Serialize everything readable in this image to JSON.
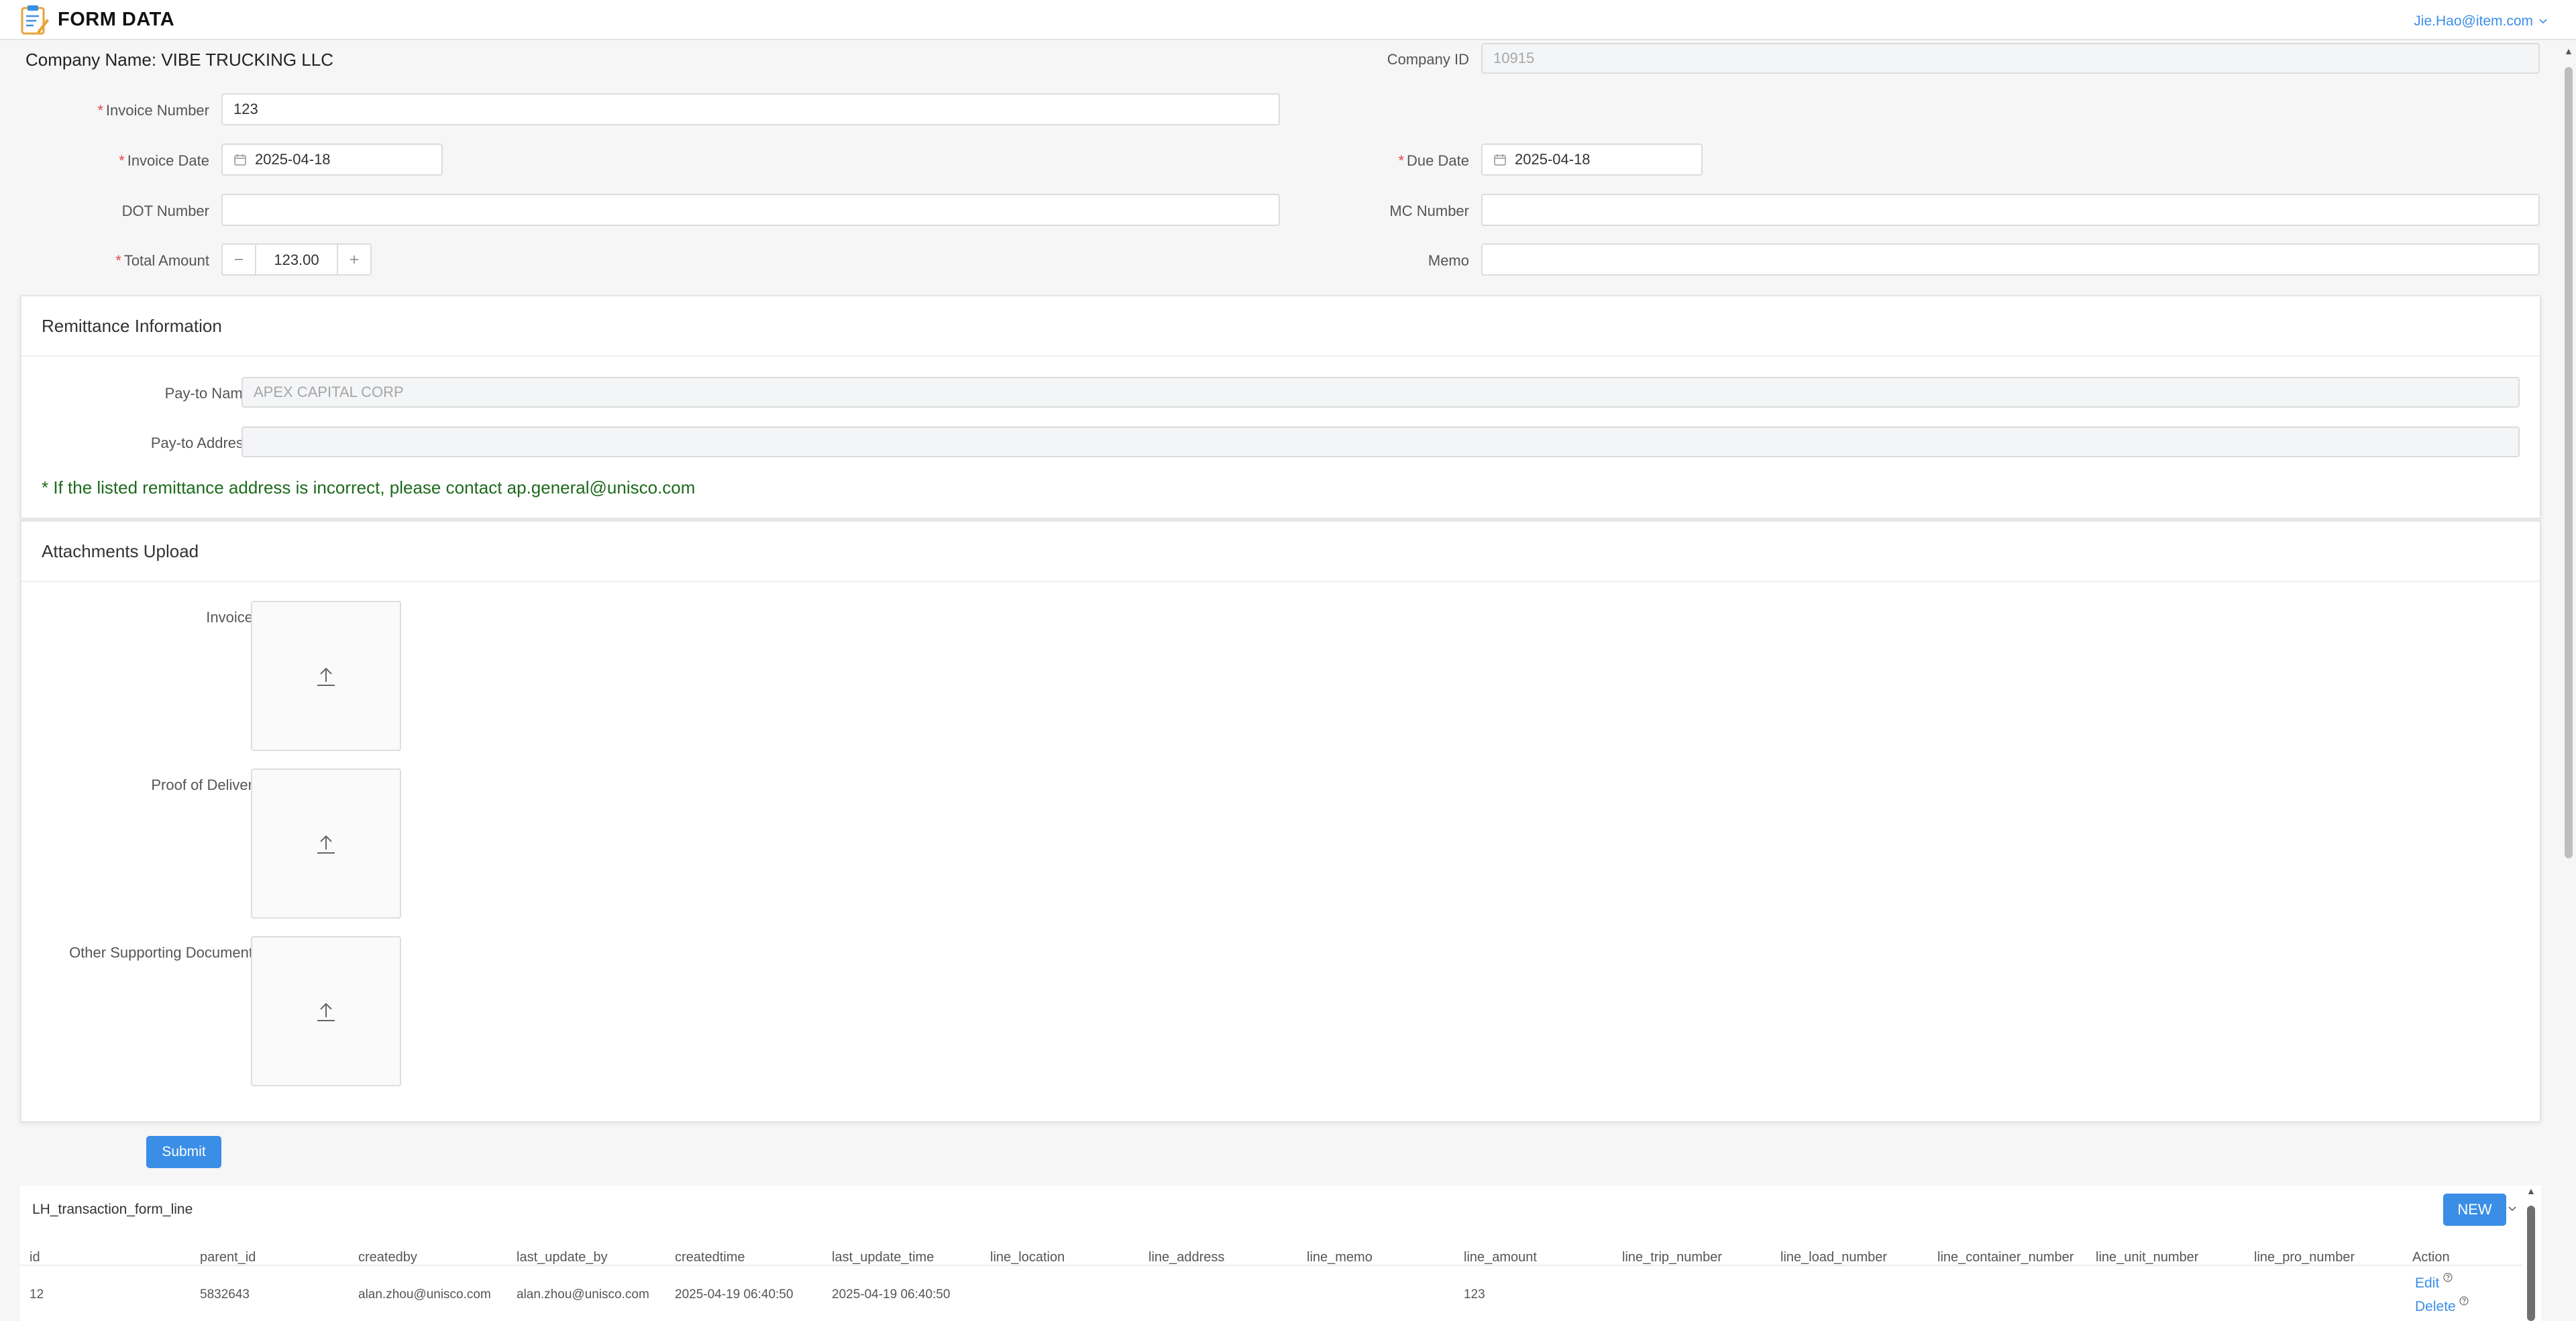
{
  "app": {
    "title": "FORM DATA",
    "user": "Jie.Hao@item.com"
  },
  "company": {
    "name": "Company Name: VIBE TRUCKING LLC",
    "id_label": "Company ID",
    "id_value": "10915"
  },
  "form": {
    "invoice_number_label": "Invoice Number",
    "invoice_number_value": "123",
    "invoice_date_label": "Invoice Date",
    "invoice_date_value": "2025-04-18",
    "due_date_label": "Due Date",
    "due_date_value": "2025-04-18",
    "dot_label": "DOT Number",
    "dot_value": "",
    "mc_label": "MC Number",
    "mc_value": "",
    "total_label": "Total Amount",
    "total_value": "123.00",
    "memo_label": "Memo",
    "memo_value": "",
    "required_mark": "*"
  },
  "remittance": {
    "title": "Remittance Information",
    "pay_to_name_label": "Pay-to Name",
    "pay_to_name_value": "APEX CAPITAL CORP",
    "pay_to_address_label": "Pay-to Address",
    "pay_to_address_value": "",
    "notice": "* If the listed remittance address is incorrect, please contact ap.general@unisco.com"
  },
  "attachments": {
    "title": "Attachments Upload",
    "invoices_label": "Invoices",
    "pod_label": "Proof of Delivery",
    "other_label": "Other Supporting Documents"
  },
  "submit_label": "Submit",
  "subtable": {
    "title": "LH_transaction_form_line",
    "new_label": "NEW",
    "columns": [
      "id",
      "parent_id",
      "createdby",
      "last_update_by",
      "createdtime",
      "last_update_time",
      "line_location",
      "line_address",
      "line_memo",
      "line_amount",
      "line_trip_number",
      "line_load_number",
      "line_container_number",
      "line_unit_number",
      "line_pro_number",
      "Action"
    ],
    "rows": [
      [
        "12",
        "5832643",
        "alan.zhou@unisco.com",
        "alan.zhou@unisco.com",
        "2025-04-19 06:40:50",
        "2025-04-19 06:40:50",
        "",
        "",
        "",
        "123",
        "",
        "",
        "",
        "",
        ""
      ]
    ],
    "edit_label": "Edit",
    "delete_label": "Delete"
  },
  "colors": {
    "primary": "#3a8ee6",
    "required": "#e64545",
    "notice": "#1d6a1d"
  },
  "icons": [
    "form-logo-icon",
    "chevron-down-icon",
    "calendar-icon",
    "minus-icon",
    "plus-icon",
    "upload-icon",
    "question-icon"
  ]
}
